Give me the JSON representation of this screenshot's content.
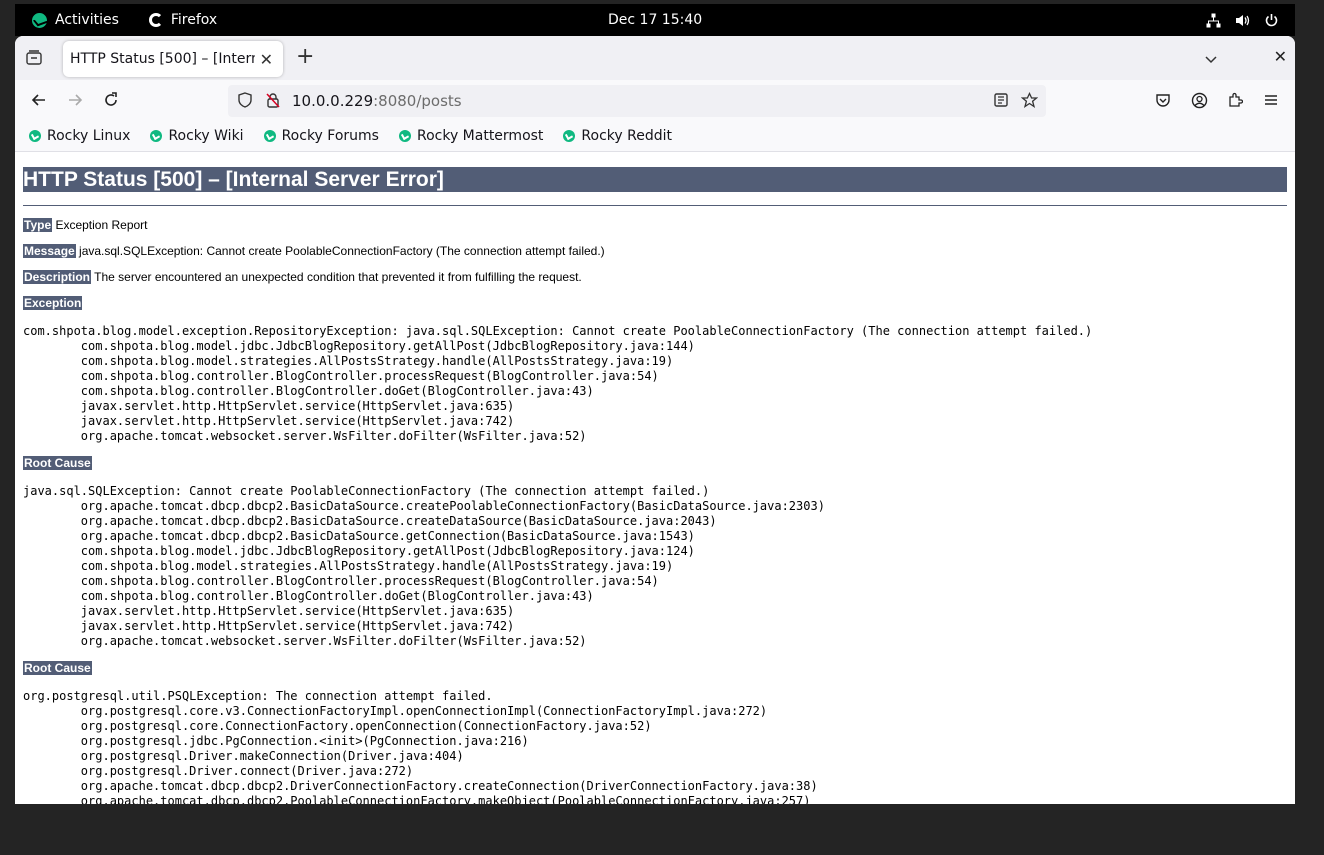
{
  "system": {
    "activities": "Activities",
    "app_name": "Firefox",
    "clock": "Dec 17  15:40"
  },
  "browser": {
    "tab_title": "HTTP Status [500] – [Internal Server Error]",
    "url_host": "10.0.0.229",
    "url_path": ":8080/posts",
    "bookmarks": [
      "Rocky Linux",
      "Rocky Wiki",
      "Rocky Forums",
      "Rocky Mattermost",
      "Rocky Reddit"
    ]
  },
  "page": {
    "heading": "HTTP Status [500] – [Internal Server Error]",
    "type_label": "Type",
    "type_value": " Exception Report",
    "message_label": "Message",
    "message_value": " java.sql.SQLException: Cannot create PoolableConnectionFactory (The connection attempt failed.)",
    "description_label": "Description",
    "description_value": " The server encountered an unexpected condition that prevented it from fulfilling the request.",
    "exception_label": "Exception",
    "exception_trace": "com.shpota.blog.model.exception.RepositoryException: java.sql.SQLException: Cannot create PoolableConnectionFactory (The connection attempt failed.)\n\tcom.shpota.blog.model.jdbc.JdbcBlogRepository.getAllPost(JdbcBlogRepository.java:144)\n\tcom.shpota.blog.model.strategies.AllPostsStrategy.handle(AllPostsStrategy.java:19)\n\tcom.shpota.blog.controller.BlogController.processRequest(BlogController.java:54)\n\tcom.shpota.blog.controller.BlogController.doGet(BlogController.java:43)\n\tjavax.servlet.http.HttpServlet.service(HttpServlet.java:635)\n\tjavax.servlet.http.HttpServlet.service(HttpServlet.java:742)\n\torg.apache.tomcat.websocket.server.WsFilter.doFilter(WsFilter.java:52)",
    "root_cause_label": "Root Cause",
    "root_cause_1": "java.sql.SQLException: Cannot create PoolableConnectionFactory (The connection attempt failed.)\n\torg.apache.tomcat.dbcp.dbcp2.BasicDataSource.createPoolableConnectionFactory(BasicDataSource.java:2303)\n\torg.apache.tomcat.dbcp.dbcp2.BasicDataSource.createDataSource(BasicDataSource.java:2043)\n\torg.apache.tomcat.dbcp.dbcp2.BasicDataSource.getConnection(BasicDataSource.java:1543)\n\tcom.shpota.blog.model.jdbc.JdbcBlogRepository.getAllPost(JdbcBlogRepository.java:124)\n\tcom.shpota.blog.model.strategies.AllPostsStrategy.handle(AllPostsStrategy.java:19)\n\tcom.shpota.blog.controller.BlogController.processRequest(BlogController.java:54)\n\tcom.shpota.blog.controller.BlogController.doGet(BlogController.java:43)\n\tjavax.servlet.http.HttpServlet.service(HttpServlet.java:635)\n\tjavax.servlet.http.HttpServlet.service(HttpServlet.java:742)\n\torg.apache.tomcat.websocket.server.WsFilter.doFilter(WsFilter.java:52)",
    "root_cause_2": "org.postgresql.util.PSQLException: The connection attempt failed.\n\torg.postgresql.core.v3.ConnectionFactoryImpl.openConnectionImpl(ConnectionFactoryImpl.java:272)\n\torg.postgresql.core.ConnectionFactory.openConnection(ConnectionFactory.java:52)\n\torg.postgresql.jdbc.PgConnection.<init>(PgConnection.java:216)\n\torg.postgresql.Driver.makeConnection(Driver.java:404)\n\torg.postgresql.Driver.connect(Driver.java:272)\n\torg.apache.tomcat.dbcp.dbcp2.DriverConnectionFactory.createConnection(DriverConnectionFactory.java:38)\n\torg.apache.tomcat.dbcp.dbcp2.PoolableConnectionFactory.makeObject(PoolableConnectionFactory.java:257)"
  },
  "colors": {
    "tomcat_header": "#525d76",
    "rocky_green": "#10b981"
  }
}
